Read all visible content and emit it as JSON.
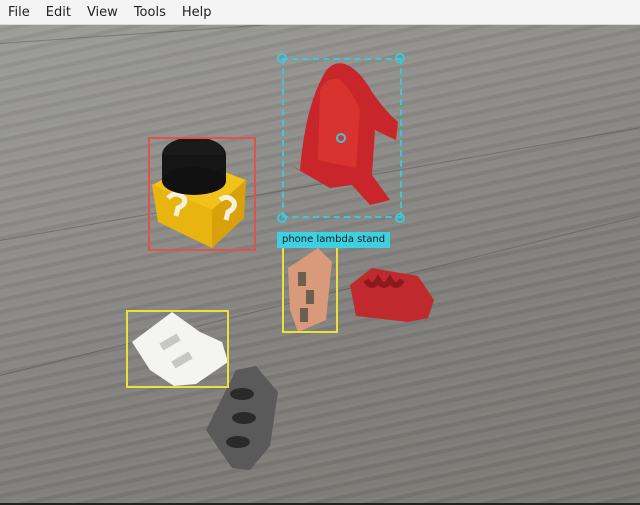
{
  "menu": {
    "file": "File",
    "edit": "Edit",
    "view": "View",
    "tools": "Tools",
    "help": "Help"
  },
  "annotations": {
    "selected_label": "phone lambda stand"
  },
  "colors": {
    "red_box": "#e0524b",
    "yellow_box": "#e8e23a",
    "selection": "#3cc8d8"
  }
}
